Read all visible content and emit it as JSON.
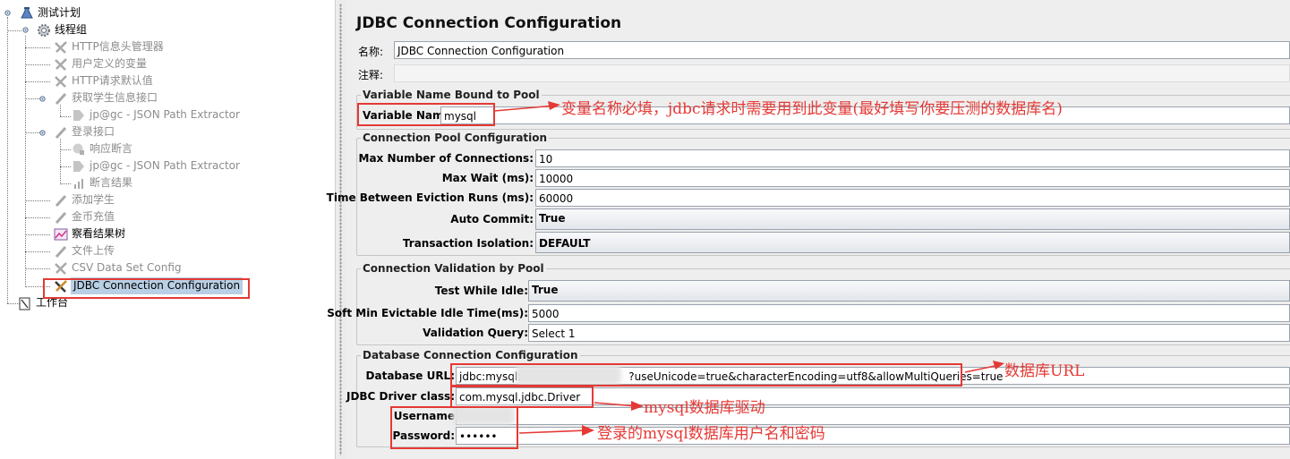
{
  "tree": {
    "root": "测试计划",
    "thread_group": "线程组",
    "items": [
      {
        "label": "HTTP信息头管理器",
        "icon": "tool-icon",
        "disabled": true
      },
      {
        "label": "用户定义的变量",
        "icon": "tool-icon",
        "disabled": true
      },
      {
        "label": "HTTP请求默认值",
        "icon": "tool-icon",
        "disabled": true
      },
      {
        "label": "获取学生信息接口",
        "icon": "sampler-icon",
        "disabled": true
      },
      {
        "label": "jp@gc - JSON Path Extractor",
        "icon": "extractor-icon",
        "disabled": true
      },
      {
        "label": "登录接口",
        "icon": "sampler-icon",
        "disabled": true
      },
      {
        "label": "响应断言",
        "icon": "assertion-icon",
        "disabled": true
      },
      {
        "label": "jp@gc - JSON Path Extractor",
        "icon": "extractor-icon",
        "disabled": true
      },
      {
        "label": "断言结果",
        "icon": "chart-icon",
        "disabled": true
      },
      {
        "label": "添加学生",
        "icon": "sampler-icon",
        "disabled": true
      },
      {
        "label": "金币充值",
        "icon": "sampler-icon",
        "disabled": true
      },
      {
        "label": "察看结果树",
        "icon": "result-tree-icon",
        "disabled": false
      },
      {
        "label": "文件上传",
        "icon": "sampler-icon",
        "disabled": true
      },
      {
        "label": "CSV Data Set Config",
        "icon": "tool-icon",
        "disabled": true
      },
      {
        "label": "JDBC Connection Configuration",
        "icon": "tool-icon",
        "disabled": false,
        "selected": true
      }
    ],
    "workbench": "工作台"
  },
  "config": {
    "title": "JDBC Connection Configuration",
    "name_label": "名称:",
    "name_value": "JDBC Connection Configuration",
    "comment_label": "注释:",
    "comment_value": "",
    "var_group": {
      "legend": "Variable Name Bound to Pool",
      "var_label": "Variable Name:",
      "var_value": "mysql"
    },
    "pool_group": {
      "legend": "Connection Pool Configuration",
      "max_conn_label": "Max Number of Connections:",
      "max_conn_value": "10",
      "max_wait_label": "Max Wait (ms):",
      "max_wait_value": "10000",
      "eviction_label": "Time Between Eviction Runs (ms):",
      "eviction_value": "60000",
      "auto_commit_label": "Auto Commit:",
      "auto_commit_value": "True",
      "isolation_label": "Transaction Isolation:",
      "isolation_value": "DEFAULT"
    },
    "validation_group": {
      "legend": "Connection Validation by Pool",
      "test_idle_label": "Test While Idle:",
      "test_idle_value": "True",
      "soft_min_label": "Soft Min Evictable Idle Time(ms):",
      "soft_min_value": "5000",
      "query_label": "Validation Query:",
      "query_value": "Select 1"
    },
    "db_group": {
      "legend": "Database Connection Configuration",
      "url_label": "Database URL:",
      "url_prefix": "jdbc:mysql:",
      "url_suffix": "?useUnicode=true&characterEncoding=utf8&allowMultiQueries=true",
      "driver_label": "JDBC Driver class:",
      "driver_value": "com.mysql.jdbc.Driver",
      "username_label": "Username",
      "username_value": "",
      "password_label": "Password:",
      "password_value": "••••••"
    }
  },
  "annotations": {
    "var_note": "变量名称必填，jdbc请求时需要用到此变量(最好填写你要压测的数据库名)",
    "url_note": "数据库URL",
    "driver_note": "mysql数据库驱动",
    "login_note": "登录的mysql数据库用户名和密码"
  },
  "colors": {
    "annotation_red": "#e53935",
    "selection_bg": "#b8cfe5",
    "panel_bg": "#eeeeee",
    "disabled_text": "#8c8c8c"
  }
}
